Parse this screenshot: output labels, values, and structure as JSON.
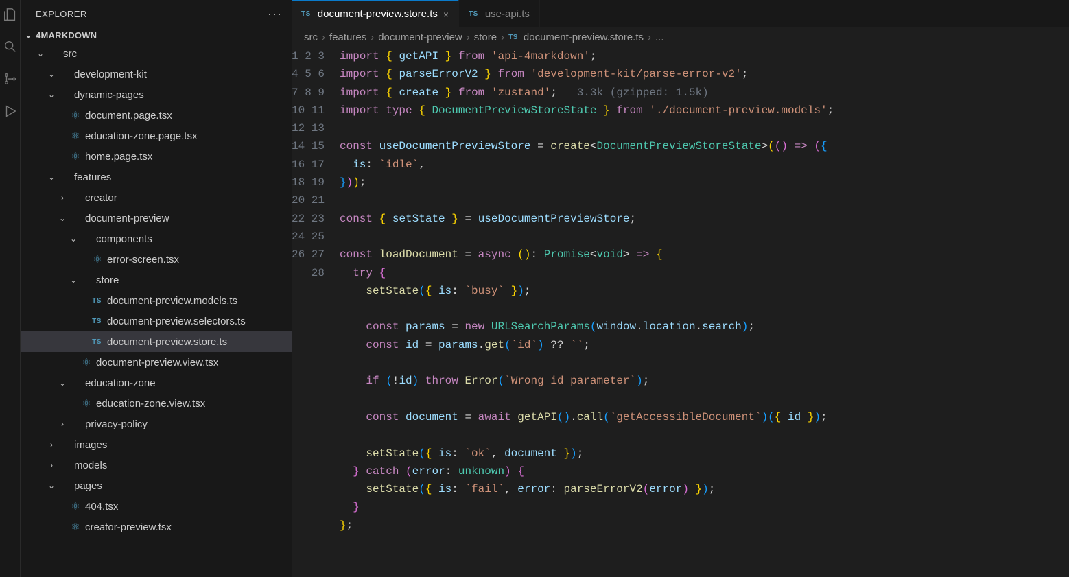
{
  "sidebar": {
    "title": "EXPLORER",
    "project": "4MARKDOWN",
    "tree": [
      {
        "depth": 1,
        "expand": "open",
        "label": "src"
      },
      {
        "depth": 2,
        "expand": "open",
        "label": "development-kit"
      },
      {
        "depth": 2,
        "expand": "open",
        "label": "dynamic-pages"
      },
      {
        "depth": 3,
        "icon": "react",
        "label": "document.page.tsx"
      },
      {
        "depth": 3,
        "icon": "react",
        "label": "education-zone.page.tsx"
      },
      {
        "depth": 3,
        "icon": "react",
        "label": "home.page.tsx"
      },
      {
        "depth": 2,
        "expand": "open",
        "label": "features"
      },
      {
        "depth": 3,
        "expand": "closed",
        "label": "creator"
      },
      {
        "depth": 3,
        "expand": "open",
        "label": "document-preview"
      },
      {
        "depth": 4,
        "expand": "open",
        "label": "components"
      },
      {
        "depth": 5,
        "icon": "react",
        "label": "error-screen.tsx"
      },
      {
        "depth": 4,
        "expand": "open",
        "label": "store"
      },
      {
        "depth": 5,
        "icon": "ts",
        "label": "document-preview.models.ts"
      },
      {
        "depth": 5,
        "icon": "ts",
        "label": "document-preview.selectors.ts"
      },
      {
        "depth": 5,
        "icon": "ts",
        "label": "document-preview.store.ts",
        "active": true
      },
      {
        "depth": 4,
        "icon": "react",
        "label": "document-preview.view.tsx"
      },
      {
        "depth": 3,
        "expand": "open",
        "label": "education-zone"
      },
      {
        "depth": 4,
        "icon": "react",
        "label": "education-zone.view.tsx"
      },
      {
        "depth": 3,
        "expand": "closed",
        "label": "privacy-policy"
      },
      {
        "depth": 2,
        "expand": "closed",
        "label": "images"
      },
      {
        "depth": 2,
        "expand": "closed",
        "label": "models"
      },
      {
        "depth": 2,
        "expand": "open",
        "label": "pages"
      },
      {
        "depth": 3,
        "icon": "react",
        "label": "404.tsx"
      },
      {
        "depth": 3,
        "icon": "react",
        "label": "creator-preview.tsx"
      }
    ]
  },
  "tabs": [
    {
      "icon": "TS",
      "label": "document-preview.store.ts",
      "active": true,
      "closable": true
    },
    {
      "icon": "TS",
      "label": "use-api.ts",
      "active": false,
      "closable": false
    }
  ],
  "breadcrumb": [
    "src",
    "features",
    "document-preview",
    "store",
    "document-preview.store.ts",
    "..."
  ],
  "breadcrumb_file_icon": "TS",
  "code": {
    "lines": 28,
    "import_hint": "3.3k (gzipped: 1.5k)",
    "tokens": {
      "l1": {
        "a": "import",
        "b": "getAPI",
        "c": "from",
        "d": "'api-4markdown'"
      },
      "l2": {
        "a": "import",
        "b": "parseErrorV2",
        "c": "from",
        "d": "'development-kit/parse-error-v2'"
      },
      "l3": {
        "a": "import",
        "b": "create",
        "c": "from",
        "d": "'zustand'"
      },
      "l4": {
        "a": "import",
        "t": "type",
        "b": "DocumentPreviewStoreState",
        "c": "from",
        "d": "'./document-preview.models'"
      },
      "l6": {
        "a": "const",
        "b": "useDocumentPreviewStore",
        "c": "create",
        "d": "DocumentPreviewStoreState"
      },
      "l7": {
        "a": "is",
        "b": "`idle`"
      },
      "l10": {
        "a": "const",
        "b": "setState",
        "c": "useDocumentPreviewStore"
      },
      "l12": {
        "a": "const",
        "b": "loadDocument",
        "c": "async",
        "d": "Promise",
        "e": "void"
      },
      "l13": {
        "a": "try"
      },
      "l14": {
        "a": "setState",
        "b": "is",
        "c": "`busy`"
      },
      "l16": {
        "a": "const",
        "b": "params",
        "c": "new",
        "d": "URLSearchParams",
        "e": "window",
        "f": "location",
        "g": "search"
      },
      "l17": {
        "a": "const",
        "b": "id",
        "c": "params",
        "d": "get",
        "e": "`id`",
        "f": "``"
      },
      "l19": {
        "a": "if",
        "b": "id",
        "c": "throw",
        "d": "Error",
        "e": "`Wrong id parameter`"
      },
      "l21": {
        "a": "const",
        "b": "document",
        "c": "await",
        "d": "getAPI",
        "e": "call",
        "f": "`getAccessibleDocument`",
        "g": "id"
      },
      "l23": {
        "a": "setState",
        "b": "is",
        "c": "`ok`",
        "d": "document"
      },
      "l24": {
        "a": "catch",
        "b": "error",
        "c": "unknown"
      },
      "l25": {
        "a": "setState",
        "b": "is",
        "c": "`fail`",
        "d": "error",
        "e": "parseErrorV2",
        "f": "error"
      }
    }
  }
}
